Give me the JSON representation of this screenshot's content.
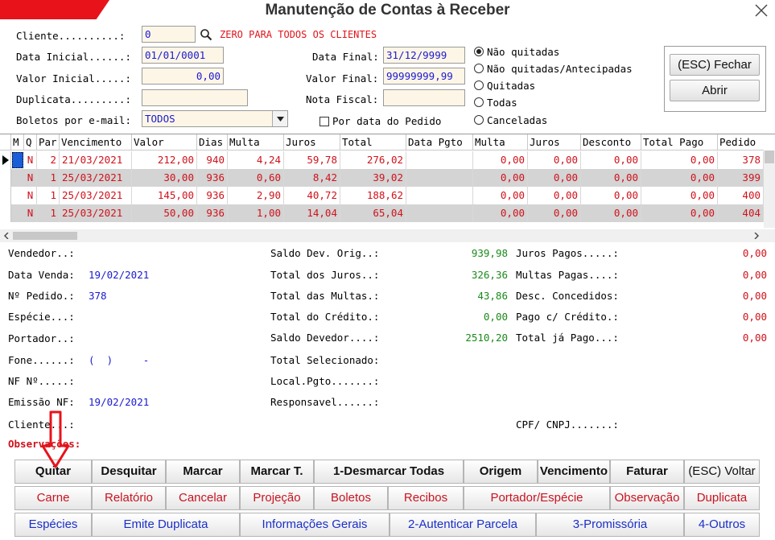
{
  "window": {
    "title": "Manutenção de Contas à Receber"
  },
  "filters": {
    "cliente_label": "Cliente..........:",
    "cliente_value": "0",
    "cliente_hint": "ZERO PARA TODOS OS CLIENTES",
    "data_inicial_label": "Data Inicial......:",
    "data_inicial_value": "01/01/0001",
    "data_final_label": "Data Final:",
    "data_final_value": "31/12/9999",
    "valor_inicial_label": "Valor Inicial.....:",
    "valor_inicial_value": "0,00",
    "valor_final_label": "Valor Final:",
    "valor_final_value": "99999999,99",
    "duplicata_label": "Duplicata.........:",
    "duplicata_value": "",
    "nota_fiscal_label": "Nota Fiscal:",
    "nota_fiscal_value": "",
    "boletos_label": "Boletos por e-mail:",
    "boletos_value": "TODOS",
    "por_data_pedido_label": "Por data do Pedido"
  },
  "status_options": [
    {
      "label": "Não quitadas",
      "selected": true
    },
    {
      "label": "Não quitadas/Antecipadas",
      "selected": false
    },
    {
      "label": "Quitadas",
      "selected": false
    },
    {
      "label": "Todas",
      "selected": false
    },
    {
      "label": "Canceladas",
      "selected": false
    }
  ],
  "actions": {
    "fechar_label": "(ESC) Fechar",
    "abrir_label": "Abrir"
  },
  "grid": {
    "columns": [
      "M",
      "Q",
      "Par",
      "Vencimento",
      "Valor",
      "Dias",
      "Multa",
      "Juros",
      "Total",
      "Data Pgto",
      "Multa",
      "Juros",
      "Desconto",
      "Total Pago",
      "Pedido"
    ],
    "rows": [
      [
        "",
        "N",
        "2",
        "21/03/2021",
        "212,00",
        "940",
        "4,24",
        "59,78",
        "276,02",
        "",
        "0,00",
        "0,00",
        "0,00",
        "0,00",
        "378"
      ],
      [
        "",
        "N",
        "1",
        "25/03/2021",
        "30,00",
        "936",
        "0,60",
        "8,42",
        "39,02",
        "",
        "0,00",
        "0,00",
        "0,00",
        "0,00",
        "399"
      ],
      [
        "",
        "N",
        "1",
        "25/03/2021",
        "145,00",
        "936",
        "2,90",
        "40,72",
        "188,62",
        "",
        "0,00",
        "0,00",
        "0,00",
        "0,00",
        "400"
      ],
      [
        "",
        "N",
        "1",
        "25/03/2021",
        "50,00",
        "936",
        "1,00",
        "14,04",
        "65,04",
        "",
        "0,00",
        "0,00",
        "0,00",
        "0,00",
        "404"
      ]
    ]
  },
  "details": {
    "vendedor_label": "Vendedor..:",
    "vendedor_value": "",
    "data_venda_label": "Data Venda:",
    "data_venda_value": "19/02/2021",
    "pedido_label": "Nº Pedido.:",
    "pedido_value": "378",
    "especie_label": "Espécie...:",
    "portador_label": "Portador..:",
    "fone_label": "Fone......:",
    "fone_value": "(  )     -",
    "nf_label": "NF Nº.....:",
    "emissao_nf_label": "Emissão NF:",
    "emissao_nf_value": "19/02/2021",
    "cliente_label": "Cliente...:",
    "observacoes_label": "Observações:",
    "saldo_dev_orig_label": "Saldo Dev. Orig..:",
    "saldo_dev_orig_value": "939,98",
    "total_juros_label": "Total dos Juros..:",
    "total_juros_value": "326,36",
    "total_multas_label": "Total das Multas.:",
    "total_multas_value": "43,86",
    "total_credito_label": "Total do Crédito.:",
    "total_credito_value": "0,00",
    "saldo_devedor_label": "Saldo Devedor....:",
    "saldo_devedor_value": "2510,20",
    "total_selecionado_label": "Total Selecionado:",
    "local_pgto_label": "Local.Pgto.......:",
    "responsavel_label": "Responsavel......:",
    "juros_pagos_label": "Juros Pagos.....:",
    "juros_pagos_value": "0,00",
    "multas_pagas_label": "Multas Pagas....:",
    "multas_pagas_value": "0,00",
    "desc_concedidos_label": "Desc. Concedidos:",
    "desc_concedidos_value": "0,00",
    "pago_credito_label": "Pago c/ Crédito.:",
    "pago_credito_value": "0,00",
    "total_ja_pago_label": "Total já Pago...:",
    "total_ja_pago_value": "0,00",
    "cpf_cnpj_label": "CPF/ CNPJ.......:"
  },
  "buttons": {
    "row1": [
      "Quitar",
      "Desquitar",
      "Marcar",
      "Marcar T.",
      "1-Desmarcar Todas",
      "Origem",
      "Vencimento",
      "Faturar",
      "(ESC) Voltar"
    ],
    "row2": [
      "Carne",
      "Relatório",
      "Cancelar",
      "Projeção",
      "Boletos",
      "Recibos",
      "Portador/Espécie",
      "Observação",
      "Duplicata"
    ],
    "row3": [
      "Espécies",
      "Emite Duplicata",
      "Informações Gerais",
      "2-Autenticar Parcela",
      "3-Promissória",
      "4-Outros"
    ]
  },
  "colors": {
    "accent_red": "#e8121b",
    "value_blue": "#1a1ad0",
    "value_green": "#1a8a1a",
    "value_red": "#d0121b"
  }
}
